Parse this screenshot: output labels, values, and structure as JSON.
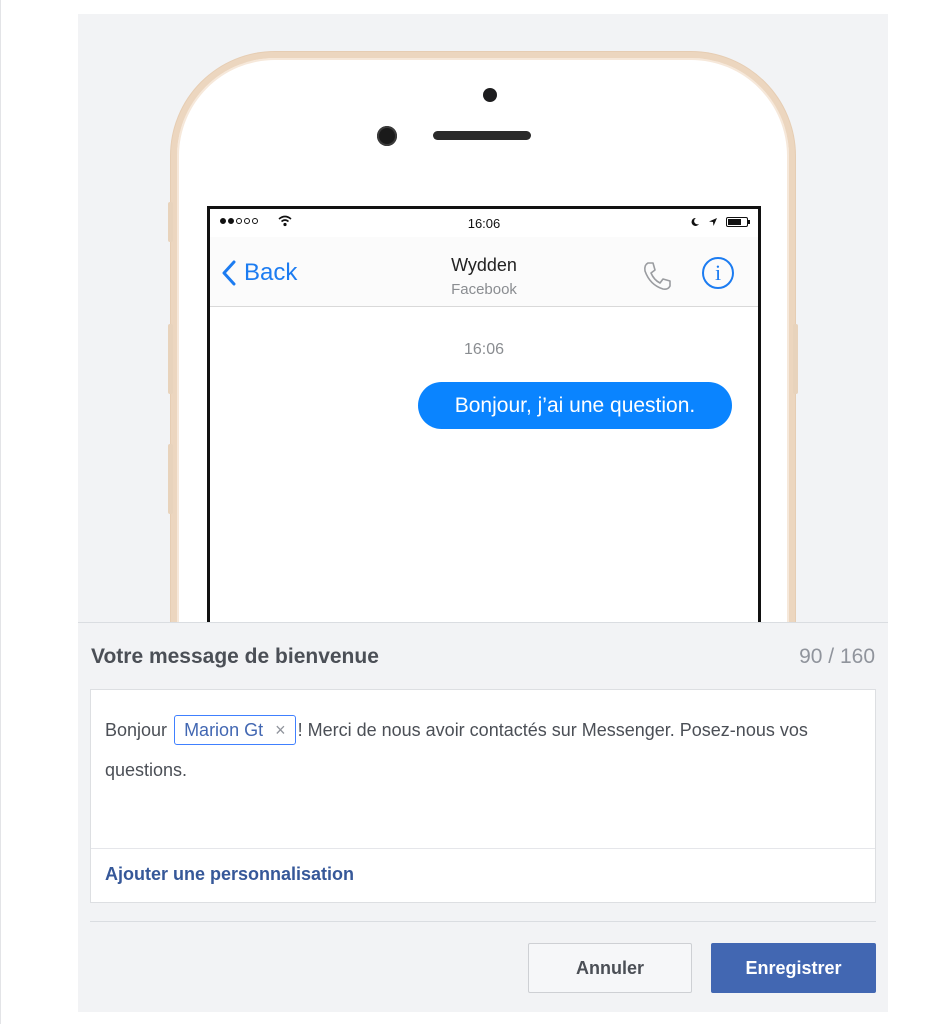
{
  "phone": {
    "status_time": "16:06",
    "nav": {
      "back_label": "Back",
      "title": "Wydden",
      "subtitle": "Facebook"
    },
    "chat": {
      "timestamp": "16:06",
      "message": "Bonjour, j’ai une question."
    },
    "icons": [
      "signal-icon",
      "wifi-icon",
      "moon-icon",
      "location-icon",
      "battery-icon",
      "chevron-left-icon",
      "phone-icon",
      "info-icon"
    ]
  },
  "form": {
    "title": "Votre message de bienvenue",
    "counter": "90 / 160",
    "message": {
      "prefix": "Bonjour",
      "token": "Marion Gt",
      "token_remove": "×",
      "suffix": "! Merci de nous avoir contactés sur Messenger. Posez-nous vos questions."
    },
    "add_personalization": "Ajouter une personnalisation"
  },
  "buttons": {
    "cancel": "Annuler",
    "save": "Enregistrer"
  },
  "colors": {
    "accent": "#4267b2",
    "messenger_blue": "#0a84ff",
    "ios_blue": "#1c7cf1",
    "background": "#f2f3f5"
  }
}
